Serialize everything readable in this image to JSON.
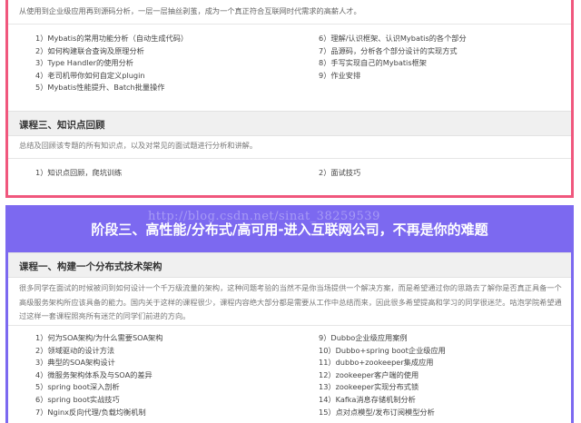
{
  "stage2": {
    "intro": "从使用到企业级应用再到源码分析，一层一层抽丝剥茧，成为一个真正符合互联网时代需求的高薪人才。",
    "left_items": [
      "1）Mybatis的常用功能分析（自动生成代码）",
      "2）如何构建联合查询及原理分析",
      "3）Type Handler的使用分析",
      "4）老司机带你如何自定义plugin",
      "5）Mybatis性能提升、Batch批量操作"
    ],
    "right_items": [
      "6）理解/认识框架、认识Mybatis的各个部分",
      "7）品源码，分析各个部分设计的实现方式",
      "8）手写实现自己的Mybatis框架",
      "9）作业安排"
    ],
    "course3": {
      "title": "课程三、知识点回顾",
      "desc": "总结及回顾该专题的所有知识点，以及对常见的面试题进行分析和讲解。",
      "left_items": [
        "1）知识点回顾，爬坑训练"
      ],
      "right_items": [
        "2）面试技巧"
      ]
    }
  },
  "stage3": {
    "banner_title": "阶段三、高性能/分布式/高可用-进入互联网公司，不再是你的难题",
    "watermark": "http://blog.csdn.net/sinat_38259539",
    "course1": {
      "title": "课程一、构建一个分布式技术架构",
      "desc": "很多同学在面试的时候被问到如何设计一个千万级流量的架构，这种问题考验的当然不是你当场提供一个解决方案，而是希望通过你的思路去了解你是否真正具备一个高级服务架构所应该具备的能力。国内关于这样的课程很少，课程内容绝大部分都是需要从工作中总结而来，因此很多希望提高和学习的同学很迷茫。咕泡学院希望通过这样一套课程照亮所有迷茫的同学们前进的方向。",
      "left_items": [
        "1）何为SOA架构/为什么需要SOA架构",
        "2）领域驱动的设计方法",
        "3）典型的SOA架构设计",
        "4）微服务架构体系及与SOA的差异",
        "5）spring boot深入剖析",
        "6）spring boot实战技巧",
        "7）Nginx反向代理/负载均衡机制"
      ],
      "right_items": [
        "9）Dubbo企业级应用案例",
        "10）Dubbo+spring boot企业级应用",
        "11）dubbo+zookeeper集成应用",
        "12）zookeeper客户端的使用",
        "13）zookeeper实现分布式锁",
        "14）Kafka消息存储机制分析",
        "15）点对点模型/发布订阅模型分析"
      ]
    }
  }
}
